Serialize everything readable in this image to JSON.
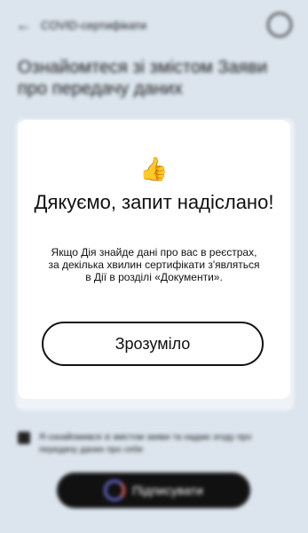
{
  "background": {
    "topbar_title": "COVID-сертифікати",
    "page_title": "Ознайомтеся зі змістом Заяви про передачу даних",
    "consent_text": "Я ознайомився зі змістом заяви та надаю згоду про передачу даних про себе",
    "sign_button_label": "Підписувати"
  },
  "modal": {
    "emoji": "👍",
    "title": "Дякуємо, запит надіслано!",
    "message": "Якщо Дія знайде дані про вас в реєстрах, за декілька хвилин сертифікати з'являться в Дії в розділі «Документи».",
    "confirm_label": "Зрозуміло"
  }
}
